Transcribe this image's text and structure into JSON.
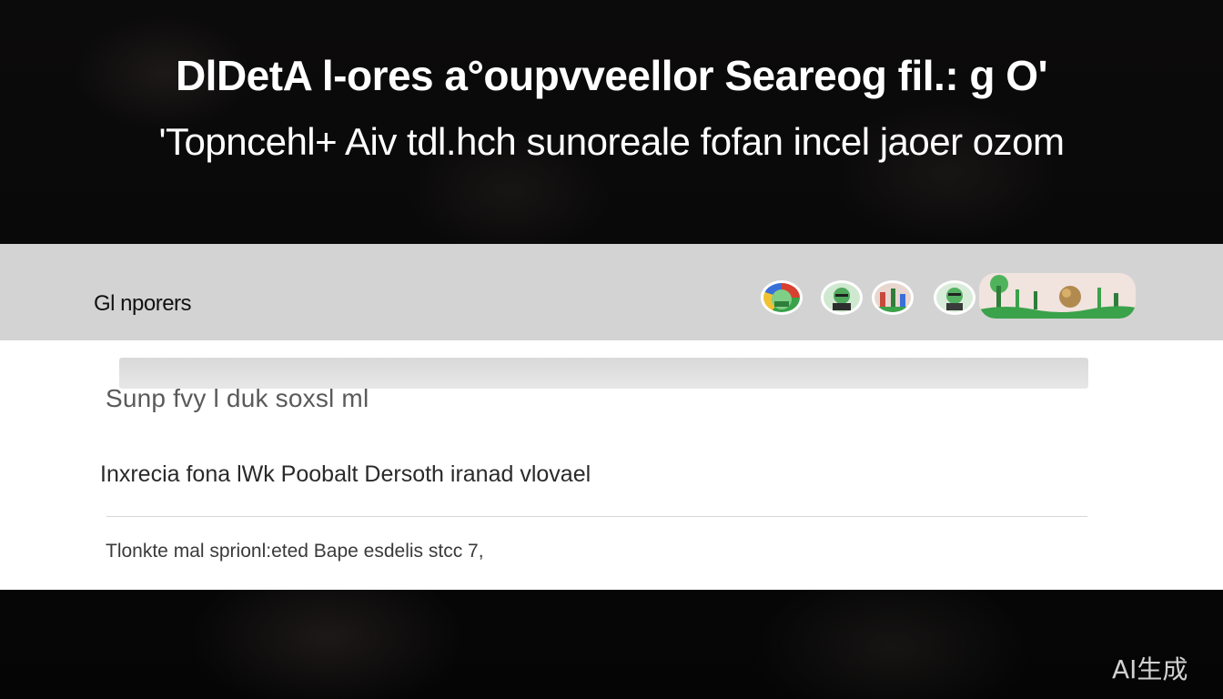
{
  "hero": {
    "headline_line1": "DlDetA l-ores a°oupvveellor Seareog fil.: g O'",
    "headline_line2": "'Topncehl+ Aiv tdl.hch sunoreale fofan incel jaoer ozom"
  },
  "toolbar": {
    "title": "Gl nporers",
    "avatars": [
      "avatar-1",
      "avatar-2",
      "avatar-3",
      "avatar-4"
    ],
    "badge_icon": "landscape-image-icon"
  },
  "search": {
    "value": "",
    "hint": "Sunp fvy l duk soxsl ml"
  },
  "results": [
    {
      "label": "Inxrecia fona lWk Poobalt Dersoth iranad vlovael"
    },
    {
      "label": "Tlonkte mal sprionl:eted Bape esdelis stcc 7,"
    }
  ],
  "watermark": "AI生成",
  "colors": {
    "background": "#0a0909",
    "toolbar": "#d3d3d3",
    "panel": "#ffffff",
    "headline": "#ffffff",
    "accent_green": "#3aa24a"
  }
}
